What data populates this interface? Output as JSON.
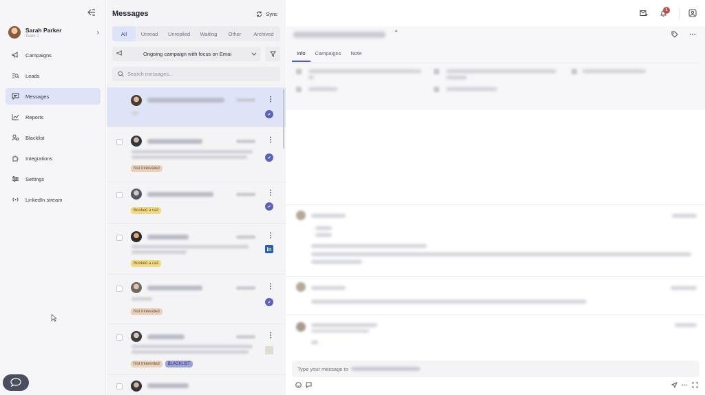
{
  "sidebar": {
    "profile": {
      "name": "Sarah Parker",
      "team": "Team 1"
    },
    "items": [
      {
        "label": "Campaigns",
        "icon": "megaphone-icon",
        "active": false
      },
      {
        "label": "Leads",
        "icon": "search-list-icon",
        "active": false
      },
      {
        "label": "Messages",
        "icon": "chat-icon",
        "active": true
      },
      {
        "label": "Reports",
        "icon": "chart-icon",
        "active": false
      },
      {
        "label": "Blacklist",
        "icon": "user-block-icon",
        "active": false
      },
      {
        "label": "Integrations",
        "icon": "puzzle-icon",
        "active": false
      },
      {
        "label": "Settings",
        "icon": "sliders-icon",
        "active": false
      },
      {
        "label": "LinkedIn stream",
        "icon": "broadcast-icon",
        "active": false
      }
    ]
  },
  "messages_pane": {
    "title": "Messages",
    "sync_label": "Sync",
    "filters": [
      "All",
      "Unread",
      "Unreplied",
      "Waiting",
      "Other",
      "Archived"
    ],
    "active_filter": "All",
    "campaign_select": "Ongoing campaign with focus on Emai",
    "search_placeholder": "Search messages...",
    "rows": [
      {
        "tags": [],
        "channel": "compass-icon"
      },
      {
        "tags": [
          "Not Interested"
        ],
        "channel": "compass-icon"
      },
      {
        "tags": [
          "Booked a call"
        ],
        "channel": "compass-icon"
      },
      {
        "tags": [
          "Booked a call"
        ],
        "channel": "linkedin-icon"
      },
      {
        "tags": [
          "Not Interested"
        ],
        "channel": "compass-icon"
      },
      {
        "tags": [
          "Not Interested",
          "BLACKLIST"
        ],
        "channel": "mail-icon"
      }
    ]
  },
  "detail": {
    "notification_count": "1",
    "tabs": [
      "Info",
      "Campaigns",
      "Note"
    ],
    "active_tab": "Info",
    "composer_placeholder": "Type your message to"
  },
  "colors": {
    "accent": "#4e5bb9",
    "selected_bg": "#dfe3f7",
    "not_interested": "#e8d2bd",
    "booked_call": "#f1d98a",
    "blacklist": "#9ea3d4",
    "badge": "#c24a4a"
  }
}
